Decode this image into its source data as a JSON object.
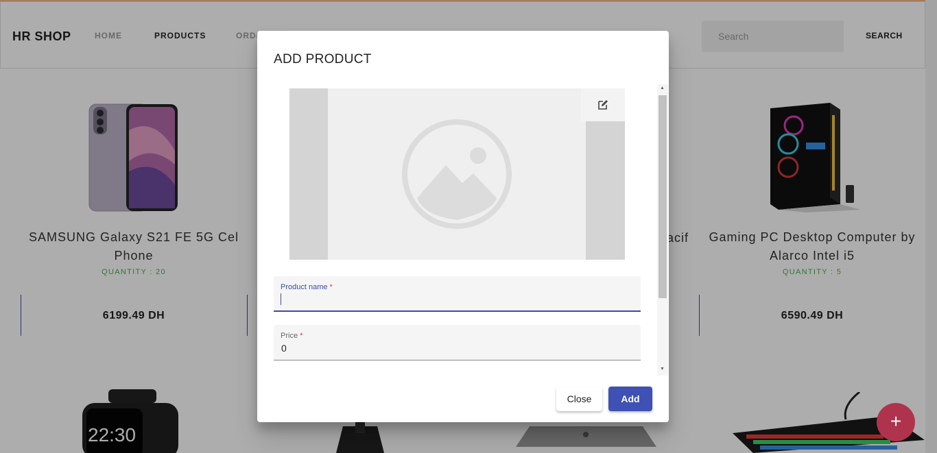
{
  "navbar": {
    "brand": "HR SHOP",
    "links": [
      "HOME",
      "PRODUCTS",
      "ORDE"
    ],
    "active": "PRODUCTS",
    "search_placeholder": "Search",
    "search_button": "SEARCH"
  },
  "products": [
    {
      "name": "SAMSUNG Galaxy S21 FE 5G Cel Phone",
      "name_line1": "SAMSUNG Galaxy S21 FE 5G Cel",
      "name_line2": "Phone",
      "quantity": "QUANTITY : 20",
      "price": "6199.49 DH"
    },
    {
      "name": "Gaming PC Desktop Computer by Alarco Intel i5",
      "name_line1": "Gaming PC Desktop Computer by",
      "name_line2": "Alarco Intel i5",
      "quantity": "QUANTITY : 5",
      "price": "6590.49 DH"
    }
  ],
  "partial_product_text": "acif",
  "dialog": {
    "title": "ADD PRODUCT",
    "image_edit_icon": "edit-icon",
    "fields": {
      "name": {
        "label": "Product name",
        "required_mark": "*",
        "value": ""
      },
      "price": {
        "label": "Price",
        "required_mark": "*",
        "value": "0"
      }
    },
    "close_label": "Close",
    "add_label": "Add"
  },
  "fab": {
    "label": "+",
    "icon": "plus-icon"
  },
  "colors": {
    "primary": "#3f51b5",
    "accent": "#b0334e",
    "quantity": "#4caf50"
  }
}
